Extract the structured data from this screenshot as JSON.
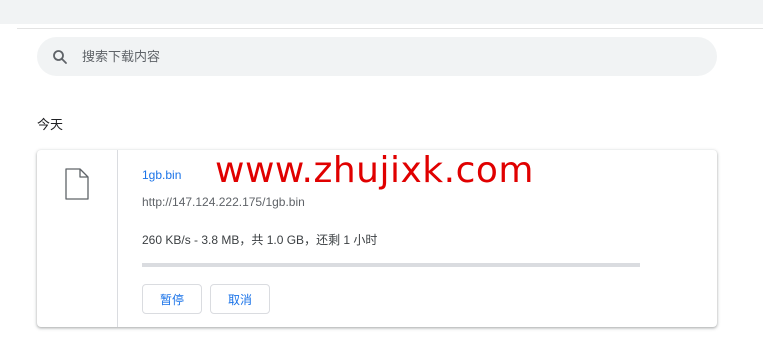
{
  "search": {
    "placeholder": "搜索下载内容",
    "icon": "search-icon"
  },
  "section": {
    "date_label": "今天"
  },
  "download": {
    "file_name": "1gb.bin",
    "url": "http://147.124.222.175/1gb.bin",
    "status": "260 KB/s - 3.8 MB，共 1.0 GB，还剩 1 小时",
    "progress_fraction": 0.0037,
    "icon": "file-icon",
    "buttons": {
      "pause": "暂停",
      "cancel": "取消"
    }
  },
  "watermark": "www.zhujixk.com",
  "colors": {
    "link": "#1a73e8",
    "watermark": "#e00000",
    "search_bg": "#f1f3f4"
  }
}
